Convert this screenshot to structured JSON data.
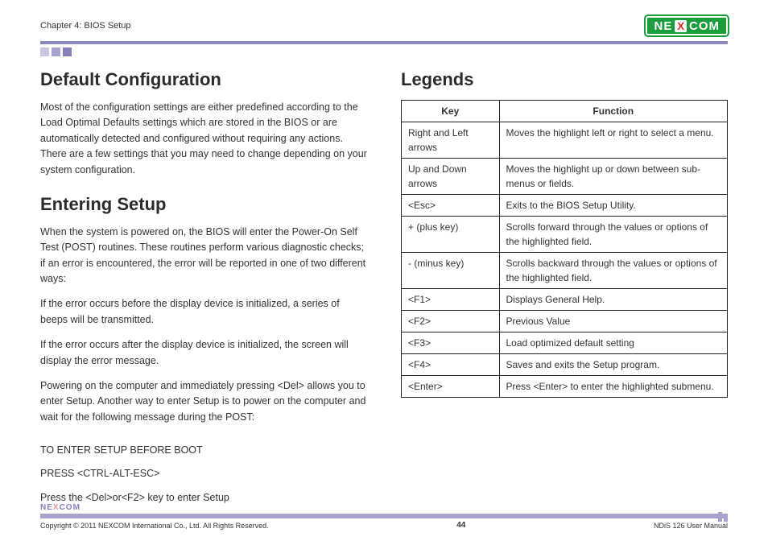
{
  "header": {
    "chapter": "Chapter 4: BIOS Setup",
    "logo_left": "NE",
    "logo_x": "X",
    "logo_right": "COM"
  },
  "left": {
    "h1": "Default Configuration",
    "p1": "Most of the configuration settings are either predefined according to the Load Optimal Defaults settings which are stored in the BIOS or are automatically detected and configured without requiring any actions. There are a few settings that you may need to change depending on your system configuration.",
    "h2": "Entering Setup",
    "p2": "When the system is powered on, the BIOS will enter the Power-On Self Test (POST) routines. These routines perform various diagnostic checks; if an error is encountered, the error will be reported in one of two different ways:",
    "p3": "If the error occurs before the display device is initialized, a series of beeps will be transmitted.",
    "p4": "If the error occurs after the display device is initialized, the screen will display the error message.",
    "p5": "Powering on the computer and immediately pressing <Del> allows you to enter Setup. Another way to enter Setup is to power on the computer and wait for the following message during the POST:",
    "s1": "TO ENTER SETUP BEFORE BOOT",
    "s2": "PRESS <CTRL-ALT-ESC>",
    "s3": "Press the <Del>or<F2> key to enter Setup"
  },
  "right": {
    "h1": "Legends",
    "th_key": "Key",
    "th_func": "Function",
    "rows": [
      {
        "key": "Right and Left arrows",
        "func": "Moves the highlight left or right to select a menu."
      },
      {
        "key": "Up and Down arrows",
        "func": "Moves the highlight up or down between sub-menus or fields."
      },
      {
        "key": "<Esc>",
        "func": "Exits to the BIOS Setup Utility."
      },
      {
        "key": "+ (plus key)",
        "func": "Scrolls forward through the values or options of the highlighted field."
      },
      {
        "key": "- (minus key)",
        "func": "Scrolls backward through the values or options of the highlighted field."
      },
      {
        "key": "<F1>",
        "func": "Displays General Help."
      },
      {
        "key": "<F2>",
        "func": "Previous Value"
      },
      {
        "key": "<F3>",
        "func": "Load optimized default setting"
      },
      {
        "key": "<F4>",
        "func": "Saves and exits the Setup program."
      },
      {
        "key": "<Enter>",
        "func": "Press <Enter> to enter the highlighted submenu."
      }
    ]
  },
  "footer": {
    "logo_left": "NE",
    "logo_x": "X",
    "logo_right": "COM",
    "copyright": "Copyright © 2011 NEXCOM International Co., Ltd. All Rights Reserved.",
    "page": "44",
    "manual": "NDiS 126 User Manual"
  }
}
